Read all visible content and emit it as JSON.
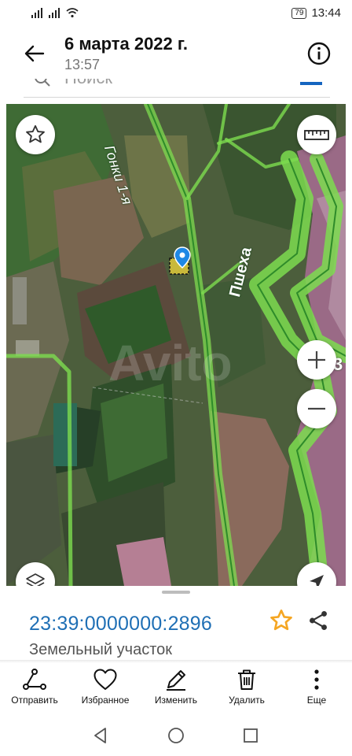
{
  "status_bar": {
    "time": "13:44",
    "battery": "79"
  },
  "header": {
    "title": "6 марта 2022 г.",
    "subtitle": "13:57"
  },
  "search": {
    "placeholder": "Поиск"
  },
  "map": {
    "labels": {
      "road": "Гонки 1-я",
      "river": "Пшеха",
      "watermark": "Avito",
      "edge_number": "3"
    }
  },
  "parcel": {
    "cadastral_number": "23:39:0000000:2896",
    "type": "Земельный участок",
    "favorite_color": "#f5a623",
    "link_color": "#1f6fb5"
  },
  "actions": [
    {
      "id": "send",
      "label": "Отправить",
      "icon": "share-route-icon"
    },
    {
      "id": "favorite",
      "label": "Избранное",
      "icon": "heart-icon"
    },
    {
      "id": "edit",
      "label": "Изменить",
      "icon": "pencil-icon"
    },
    {
      "id": "delete",
      "label": "Удалить",
      "icon": "trash-icon"
    },
    {
      "id": "more",
      "label": "Еще",
      "icon": "more-vertical-icon"
    }
  ],
  "colors": {
    "boundary_green": "#7ddc4f",
    "parcel_marker": "#1e88e5"
  }
}
